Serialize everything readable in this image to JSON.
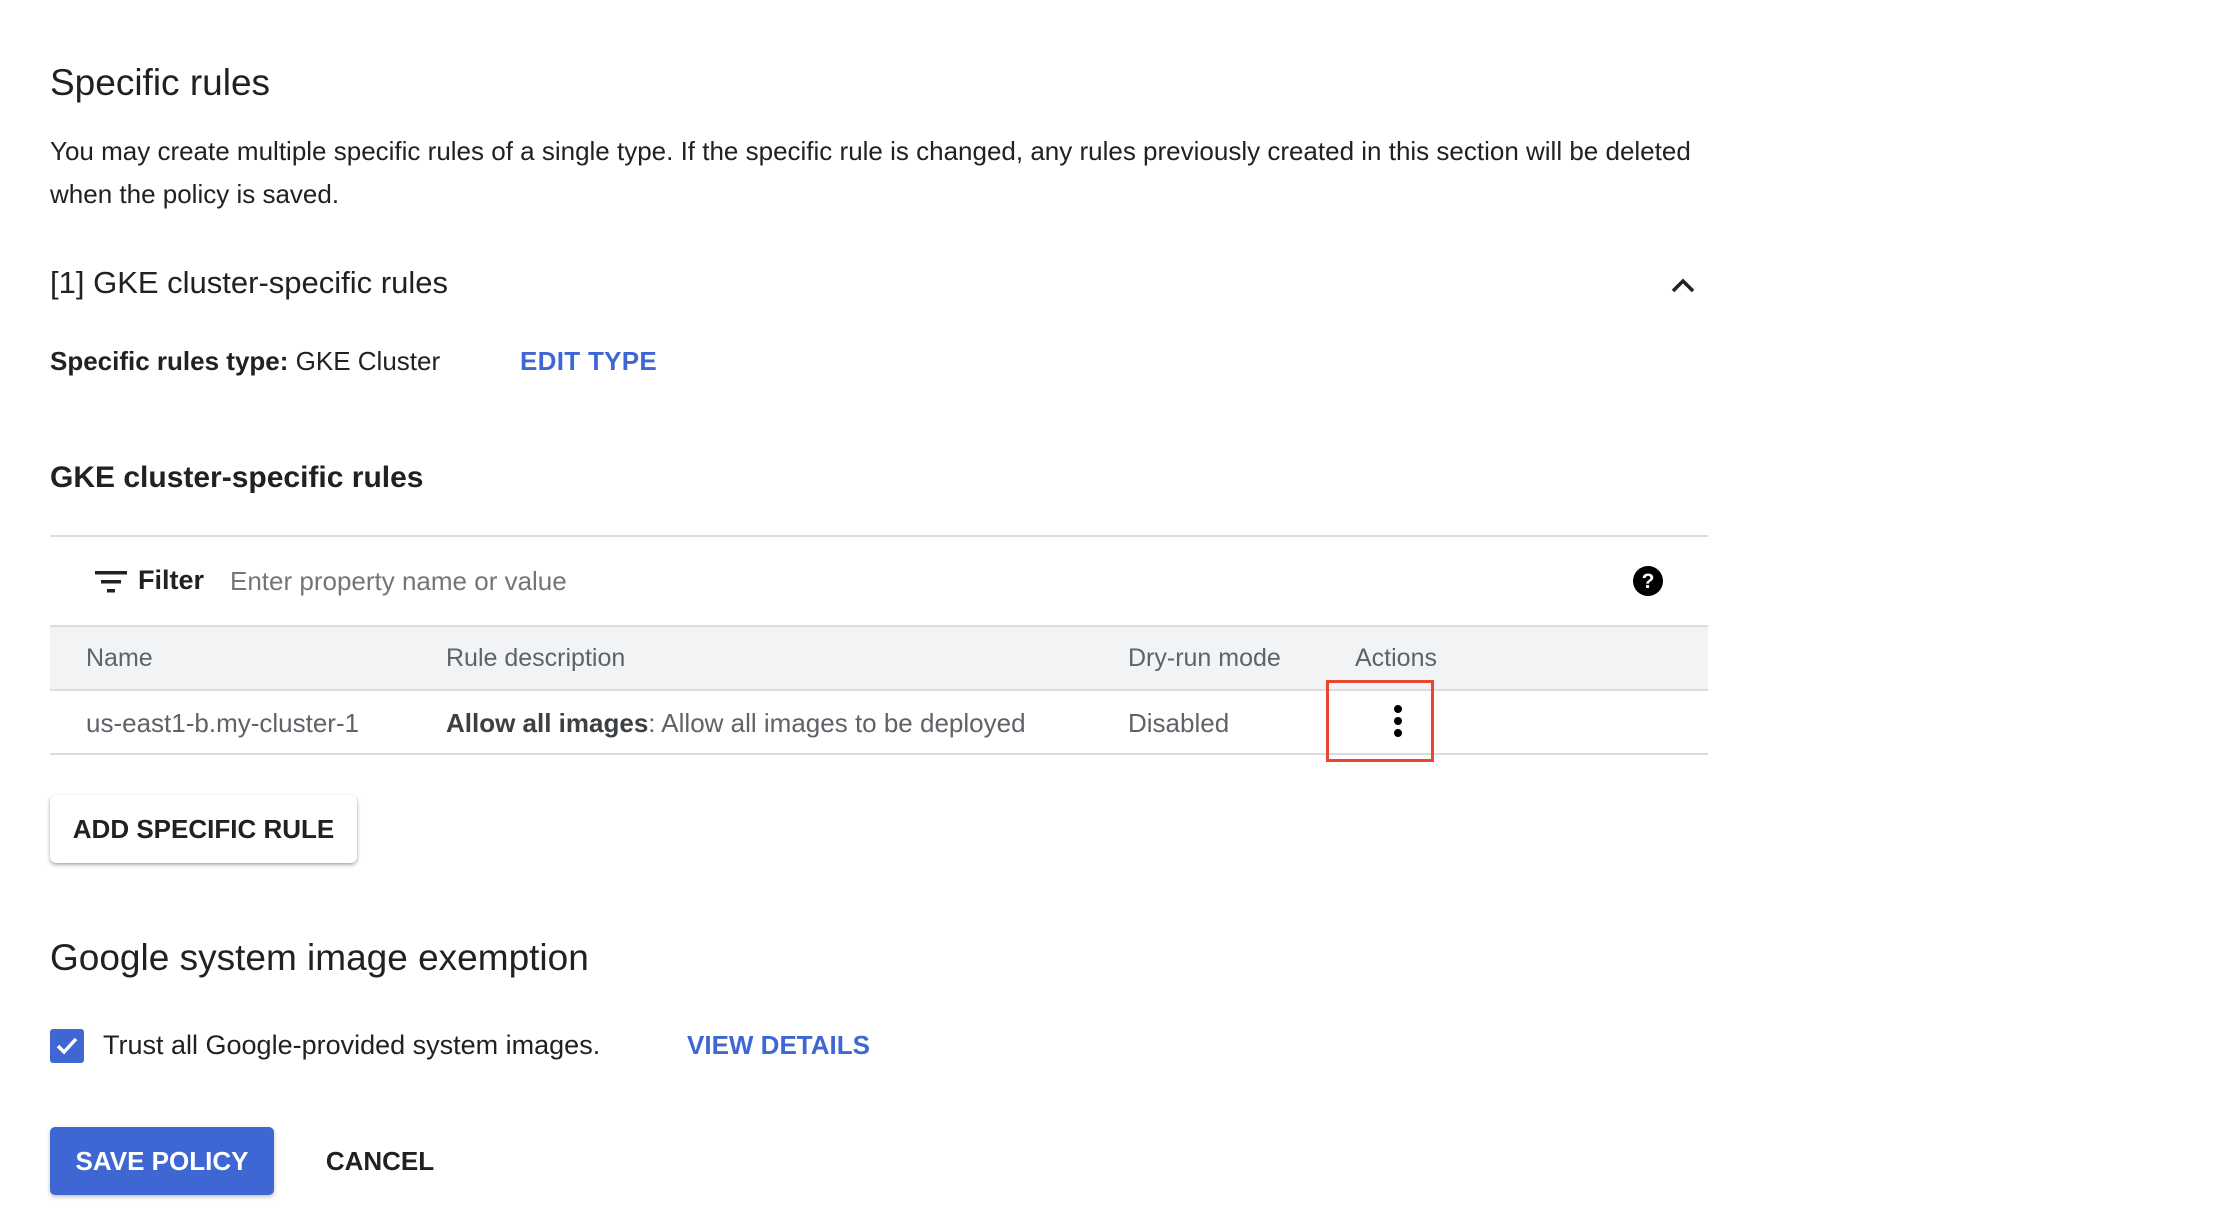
{
  "specific_rules": {
    "title": "Specific rules",
    "description": "You may create multiple specific rules of a single type. If the specific rule is changed, any rules previously created in this section will be deleted when the policy is saved.",
    "group_title": "[1] GKE cluster-specific rules",
    "collapse_icon": "chevron-up-icon",
    "type_label": "Specific rules type:",
    "type_value": " GKE Cluster",
    "edit_type_label": "EDIT TYPE",
    "table_title": "GKE cluster-specific rules",
    "filter": {
      "icon": "filter-icon",
      "label": "Filter",
      "placeholder": "Enter property name or value",
      "value": "",
      "help_icon": "help-icon"
    },
    "columns": [
      "Name",
      "Rule description",
      "Dry-run mode",
      "Actions"
    ],
    "rows": [
      {
        "name": "us-east1-b.my-cluster-1",
        "rule_bold": "Allow all images",
        "rule_text": ": Allow all images to be deployed",
        "dry_run": "Disabled",
        "actions_icon": "more-vert-icon"
      }
    ],
    "highlight_color": "#e8472e",
    "add_button_label": "ADD SPECIFIC RULE"
  },
  "exemption": {
    "title": "Google system image exemption",
    "checkbox_checked": true,
    "checkbox_label": "Trust all Google-provided system images.",
    "view_details_label": "VIEW DETAILS"
  },
  "footer": {
    "save_label": "SAVE POLICY",
    "cancel_label": "CANCEL"
  },
  "colors": {
    "accent": "#3f67d4",
    "text": "#202124",
    "muted": "#5f6368"
  }
}
